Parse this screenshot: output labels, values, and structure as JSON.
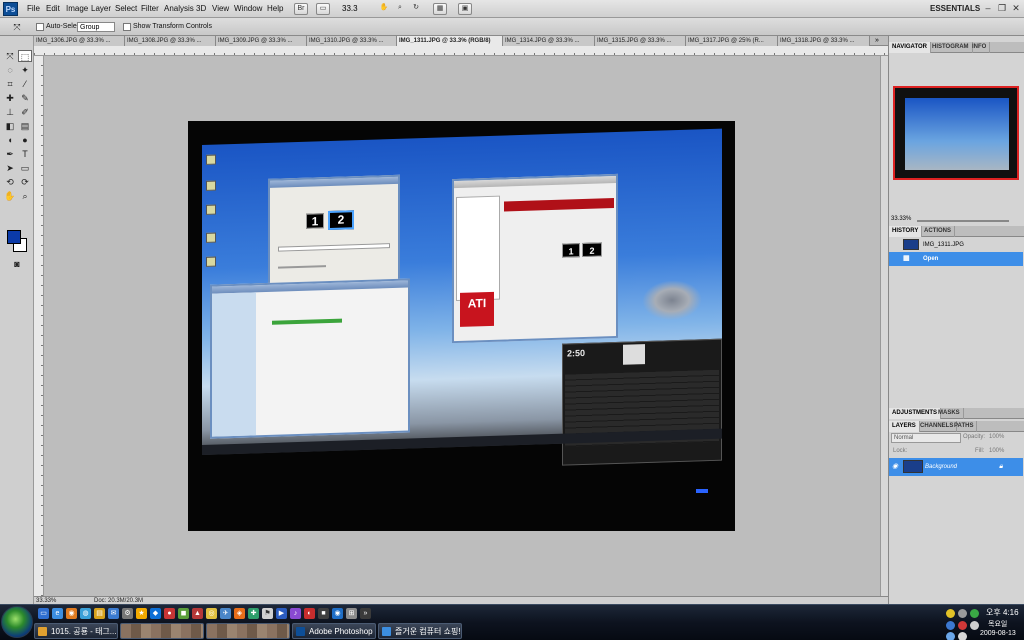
{
  "menubar": {
    "items": [
      "File",
      "Edit",
      "Image",
      "Layer",
      "Select",
      "Filter",
      "Analysis",
      "3D",
      "View",
      "Window",
      "Help"
    ],
    "zoom": "33.3",
    "workspace": "ESSENTIALS"
  },
  "options": {
    "auto_select_label": "Auto-Select:",
    "group_value": "Group",
    "transform_label": "Show Transform Controls"
  },
  "tabs": [
    "IMG_1306.JPG @ 33.3% ...",
    "IMG_1308.JPG @ 33.3% ...",
    "IMG_1309.JPG @ 33.3% ...",
    "IMG_1310.JPG @ 33.3% ...",
    "IMG_1311.JPG @ 33.3% (RGB/8)",
    "IMG_1314.JPG @ 33.3% ...",
    "IMG_1315.JPG @ 33.3% ...",
    "IMG_1317.JPG @ 25% (R...",
    "IMG_1318.JPG @ 33.3% ..."
  ],
  "status": {
    "zoom": "33.33%",
    "doc": "Doc: 20.3M/20.3M"
  },
  "photo": {
    "clock": "2:50",
    "monitors": [
      "1",
      "2"
    ],
    "ati": "ATI"
  },
  "panels": {
    "nav_tabs": [
      "NAVIGATOR",
      "HISTOGRAM",
      "INFO"
    ],
    "nav_zoom": "33.33%",
    "history_tabs": [
      "HISTORY",
      "ACTIONS"
    ],
    "history_items": [
      "IMG_1311.JPG",
      "Open"
    ],
    "adjust_tabs": [
      "ADJUSTMENTS",
      "MASKS"
    ],
    "layer_tabs": [
      "LAYERS",
      "CHANNELS",
      "PATHS"
    ],
    "blend_mode": "Normal",
    "opacity_label": "Opacity:",
    "opacity": "100%",
    "lock_label": "Lock:",
    "fill_label": "Fill:",
    "fill": "100%",
    "layer_name": "Background"
  },
  "taskbar": {
    "buttons": [
      "1015. 공룡 - 태그...",
      "Adobe Photoshop ...",
      "즐거운 컴퓨터 쇼핑!..."
    ],
    "time": "오후 4:16",
    "day": "목요일",
    "date": "2009-08-13"
  }
}
